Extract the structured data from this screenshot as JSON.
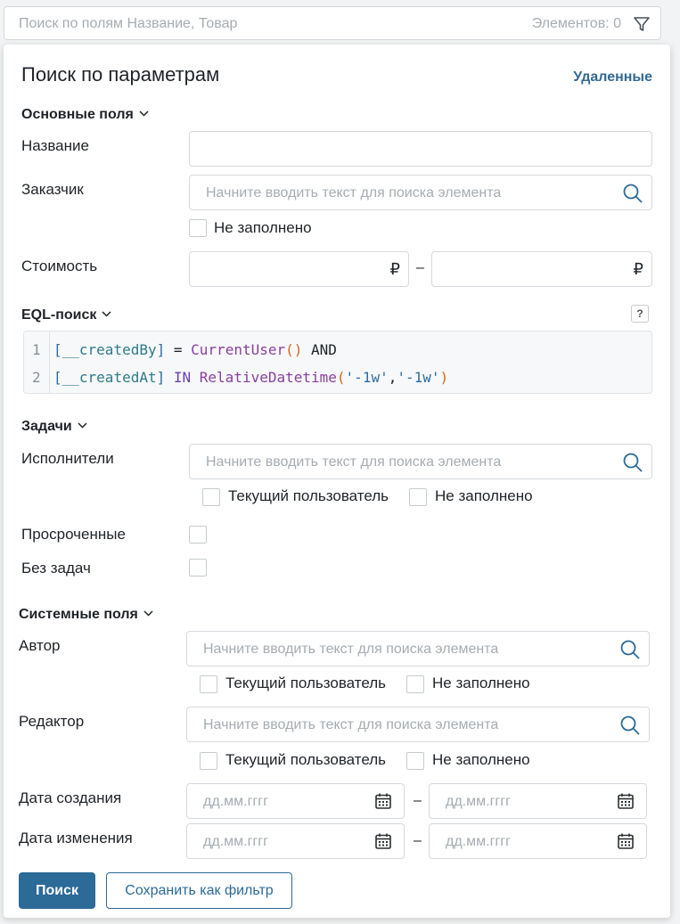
{
  "topbar": {
    "search_placeholder": "Поиск по полям Название, Товар",
    "elements_count": "Элементов: 0"
  },
  "panel": {
    "title": "Поиск по параметрам",
    "deleted_link": "Удаленные"
  },
  "main_fields": {
    "section_label": "Основные поля",
    "name_label": "Название",
    "customer_label": "Заказчик",
    "customer_placeholder": "Начните вводить текст для поиска элемента",
    "customer_empty_label": "Не заполнено",
    "cost_label": "Стоимость",
    "currency": "₽",
    "range_dash": "–"
  },
  "eql": {
    "section_label": "EQL-поиск",
    "help_icon": "?",
    "line_numbers": [
      "1",
      "2"
    ],
    "line1": {
      "b1": "[",
      "id": "__createdBy",
      "b2": "]",
      "op": " = ",
      "fn": "CurrentUser",
      "p": "()",
      "kw": " AND"
    },
    "line2": {
      "b1": "[",
      "id": "__createdAt",
      "b2": "]",
      "kw": " IN ",
      "fn": "RelativeDatetime",
      "p1": "(",
      "s1": "'-1w'",
      "comma": ",",
      "s2": "'-1w'",
      "p2": ")"
    }
  },
  "tasks": {
    "section_label": "Задачи",
    "assignees_label": "Исполнители",
    "assignees_placeholder": "Начните вводить текст для поиска элемента",
    "current_user_label": "Текущий пользователь",
    "empty_label": "Не заполнено",
    "overdue_label": "Просроченные",
    "no_tasks_label": "Без задач"
  },
  "system_fields": {
    "section_label": "Системные поля",
    "author_label": "Автор",
    "author_placeholder": "Начните вводить текст для поиска элемента",
    "editor_label": "Редактор",
    "editor_placeholder": "Начните вводить текст для поиска элемента",
    "current_user_label": "Текущий пользователь",
    "empty_label": "Не заполнено",
    "created_label": "Дата создания",
    "modified_label": "Дата изменения",
    "date_placeholder": "дд.мм.гггг",
    "range_dash": "–"
  },
  "actions": {
    "search_button": "Поиск",
    "save_filter_button": "Сохранить как фильтр"
  },
  "icons": {
    "filter": "filter-icon",
    "search": "search-icon",
    "calendar": "calendar-icon",
    "chevron": "chevron-down-icon"
  },
  "colors": {
    "accent": "#2c6a98",
    "link": "#336b94",
    "placeholder": "#a6acb2"
  }
}
